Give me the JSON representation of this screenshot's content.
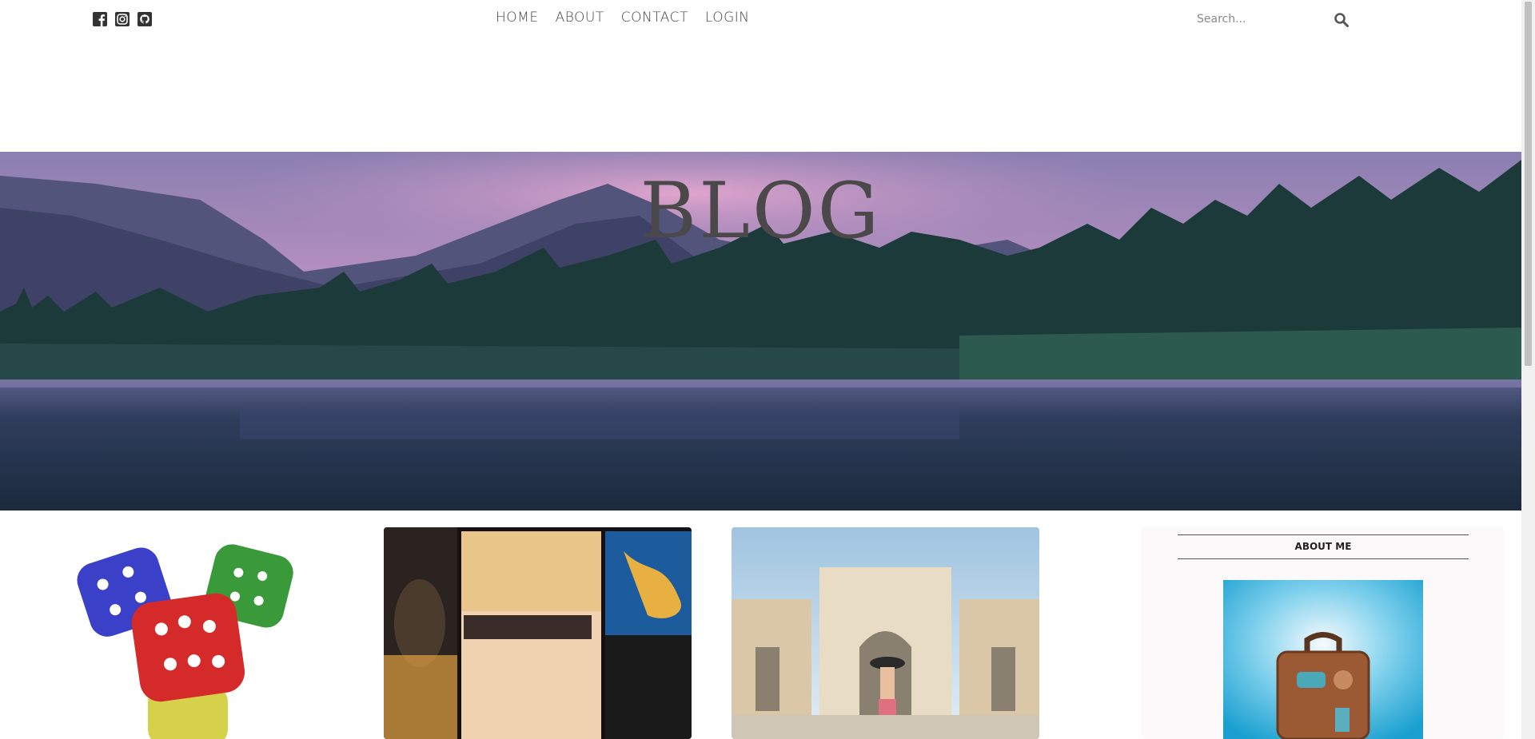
{
  "header": {
    "social": [
      {
        "name": "facebook-icon"
      },
      {
        "name": "instagram-icon"
      },
      {
        "name": "github-icon"
      }
    ],
    "nav": [
      "HOME",
      "ABOUT",
      "CONTACT",
      "LOGIN"
    ],
    "search": {
      "placeholder": "Search...",
      "value": "",
      "icon": "search-icon"
    }
  },
  "hero": {
    "title": "BLOG",
    "image": "mountain-lake-forest-at-dusk"
  },
  "posts": [
    {
      "image": "colorful-dice"
    },
    {
      "image": "sadhguru-book-covers"
    },
    {
      "image": "traveler-at-palace-gate"
    }
  ],
  "sidebar": {
    "about_heading": "ABOUT ME",
    "image": "suitcase-on-beach"
  },
  "colors": {
    "text_dark": "#444444",
    "hero_title": "#4a4848",
    "sidebar_bg": "#fbf9fa"
  }
}
